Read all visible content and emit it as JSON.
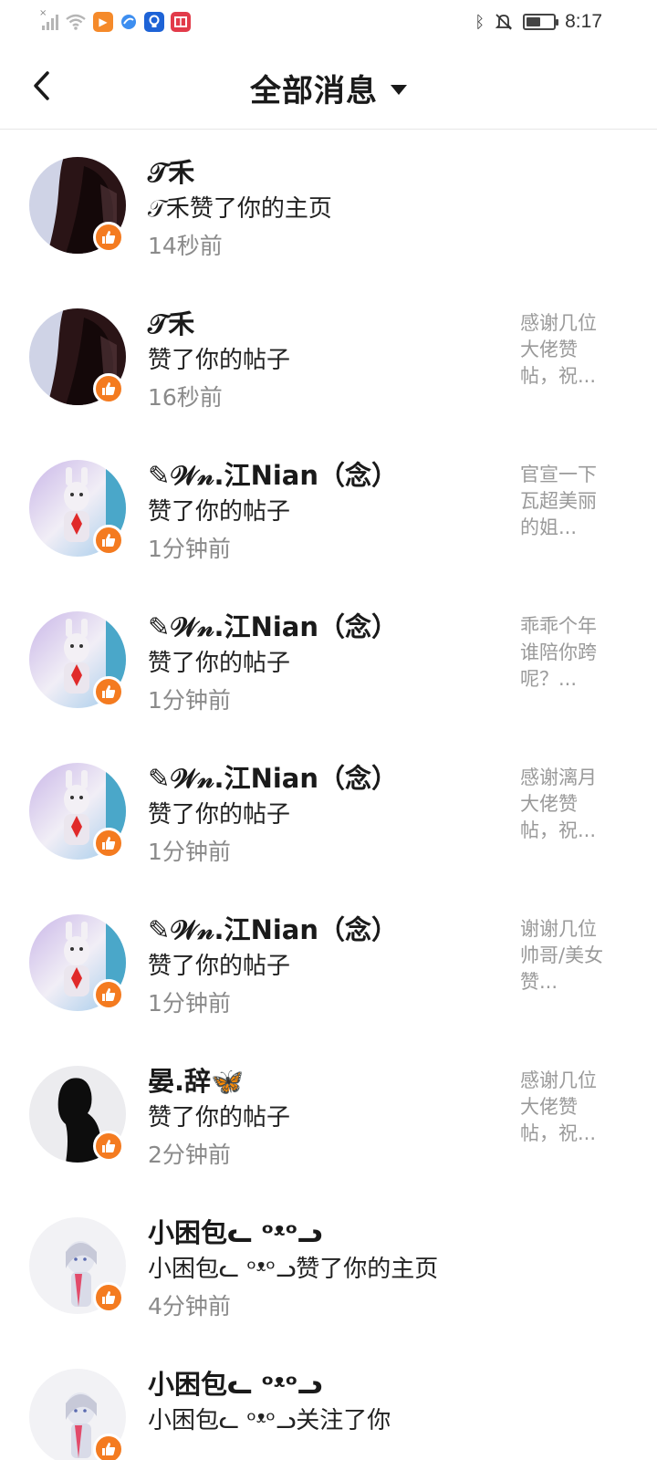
{
  "status_bar": {
    "time": "8:17",
    "icons": [
      "signal-off-icon",
      "wifi-icon",
      "video-app-icon",
      "browser-app-icon",
      "bulb-app-icon",
      "book-app-icon",
      "bluetooth-icon",
      "mute-icon",
      "battery-icon"
    ]
  },
  "header": {
    "title": "全部消息",
    "back_icon": "chevron-left-icon",
    "dropdown_icon": "triangle-down-icon"
  },
  "notifications": [
    {
      "name": "𝒯禾",
      "action": "𝒯禾赞了你的主页",
      "time": "14秒前",
      "preview": [],
      "avatar": "dark"
    },
    {
      "name": "𝒯禾",
      "action": "赞了你的帖子",
      "time": "16秒前",
      "preview": [
        "感谢几位",
        "大佬赞",
        "帖，祝..."
      ],
      "avatar": "dark"
    },
    {
      "name": "✎𝒲𝓃.江Nian（念）",
      "action": "赞了你的帖子",
      "time": "1分钟前",
      "preview": [
        "官宣一下",
        "瓦超美丽",
        "的姐..."
      ],
      "avatar": "bunny"
    },
    {
      "name": "✎𝒲𝓃.江Nian（念）",
      "action": "赞了你的帖子",
      "time": "1分钟前",
      "preview": [
        "乖乖个年",
        "谁陪你跨",
        "呢？..."
      ],
      "avatar": "bunny"
    },
    {
      "name": "✎𝒲𝓃.江Nian（念）",
      "action": "赞了你的帖子",
      "time": "1分钟前",
      "preview": [
        "感谢漓月",
        "大佬赞",
        "帖，祝..."
      ],
      "avatar": "bunny"
    },
    {
      "name": "✎𝒲𝓃.江Nian（念）",
      "action": "赞了你的帖子",
      "time": "1分钟前",
      "preview": [
        "谢谢几位",
        "帅哥/美女",
        "赞..."
      ],
      "avatar": "bunny"
    },
    {
      "name": "晏.辞🦋",
      "action": "赞了你的帖子",
      "time": "2分钟前",
      "preview": [
        "感谢几位",
        "大佬赞",
        "帖，祝..."
      ],
      "avatar": "silhouette"
    },
    {
      "name": "小困包ᓚ ᵒᵜᵒᓗ",
      "action": "小困包ᓚ ᵒᵜᵒᓗ赞了你的主页",
      "time": "4分钟前",
      "preview": [],
      "avatar": "anime"
    },
    {
      "name": "小困包ᓚ ᵒᵜᵒᓗ",
      "action": "小困包ᓚ ᵒᵜᵒᓗ关注了你",
      "time": "",
      "preview": [],
      "avatar": "anime"
    }
  ]
}
